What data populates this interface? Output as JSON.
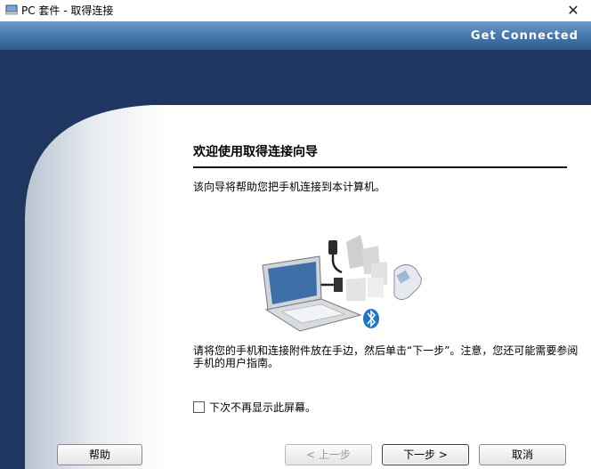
{
  "window": {
    "title": "PC 套件 - 取得连接",
    "close_glyph": "✕"
  },
  "header": {
    "brand_text": "Get Connected"
  },
  "wizard": {
    "heading": "欢迎使用取得连接向导",
    "intro": "该向导将帮助您把手机连接到本计算机。",
    "instruction": "请将您的手机和连接附件放在手边，然后单击“下一步”。注意，您还可能需要参阅手机的用户指南。",
    "checkbox_label": "下次不再显示此屏幕。",
    "checkbox_checked": false
  },
  "buttons": {
    "help": "帮助",
    "back": "< 上一步",
    "next": "下一步 >",
    "cancel": "取消"
  },
  "colors": {
    "header_band": "#4a7cb1",
    "navy_background": "#1f3760",
    "panel": "#ffffff",
    "bluetooth": "#1f73c8"
  },
  "icons": {
    "app": "pc-suite-icon",
    "close": "close-icon",
    "illustration": "laptop-phone-connection-icon",
    "bluetooth": "bluetooth-icon"
  }
}
